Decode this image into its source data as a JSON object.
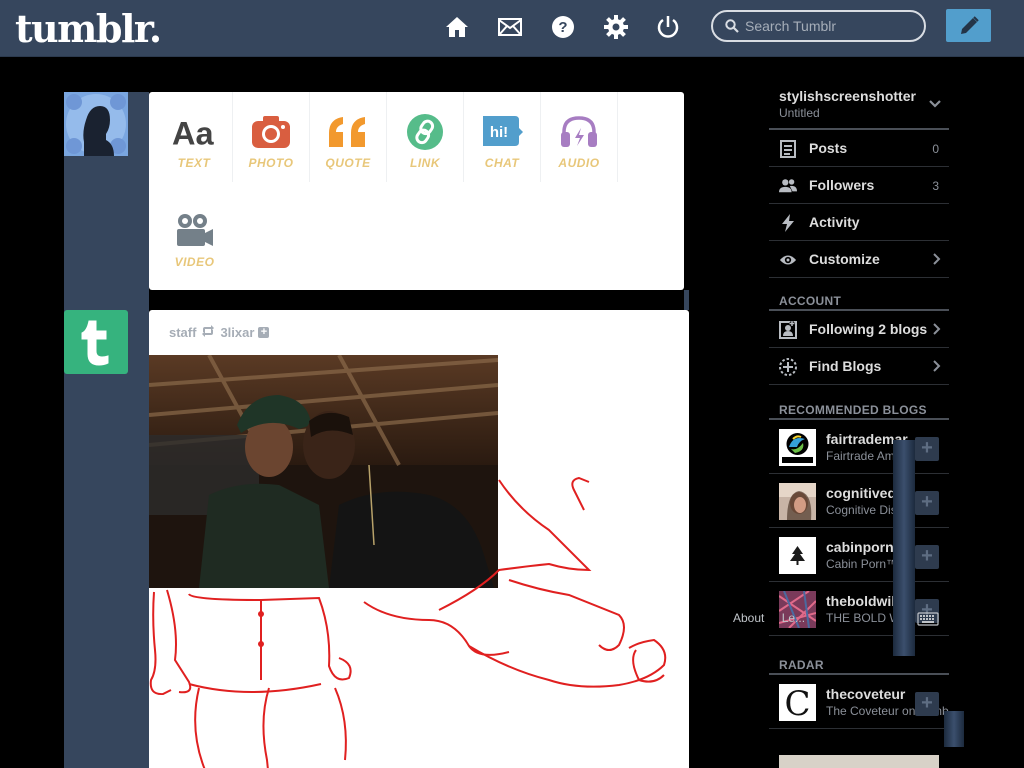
{
  "header": {
    "logo": "tumblr.",
    "nav_icons": [
      "home-icon",
      "mail-icon",
      "help-icon",
      "gear-icon",
      "power-icon"
    ],
    "search_placeholder": "Search Tumblr",
    "compose_icon": "pencil-icon",
    "colors": {
      "background": "#36465d",
      "accent": "#529ecc"
    }
  },
  "composer": {
    "post_types": [
      {
        "label": "TEXT",
        "icon": "text-aa-icon",
        "color": "#444444"
      },
      {
        "label": "PHOTO",
        "icon": "camera-icon",
        "color": "#d95e40"
      },
      {
        "label": "QUOTE",
        "icon": "quote-icon",
        "color": "#f2992e"
      },
      {
        "label": "LINK",
        "icon": "link-icon",
        "color": "#56bc8a"
      },
      {
        "label": "CHAT",
        "icon": "chat-icon",
        "color": "#529ecc"
      },
      {
        "label": "AUDIO",
        "icon": "headphones-icon",
        "color": "#a77dc2"
      },
      {
        "label": "VIDEO",
        "icon": "video-camera-icon",
        "color": "#748089"
      }
    ]
  },
  "post": {
    "author": "staff",
    "reblog_icon": "reblog-icon",
    "reblogged_from": "3lixar",
    "follow_icon": "plus-icon"
  },
  "sidebar": {
    "blog_name": "stylishscreenshotter",
    "blog_title": "Untitled",
    "items": [
      {
        "label": "Posts",
        "count": "0",
        "icon": "posts-icon"
      },
      {
        "label": "Followers",
        "count": "3",
        "icon": "followers-icon"
      },
      {
        "label": "Activity",
        "count": "",
        "icon": "lightning-icon"
      },
      {
        "label": "Customize",
        "count": "",
        "icon": "eye-icon"
      }
    ],
    "account_heading": "ACCOUNT",
    "account_items": [
      {
        "label": "Following 2 blogs",
        "icon": "following-icon"
      },
      {
        "label": "Find Blogs",
        "icon": "compass-icon"
      }
    ],
    "recommended_heading": "RECOMMENDED BLOGS",
    "recommended": [
      {
        "name": "fairtrademar",
        "desc": "Fairtrade Ame"
      },
      {
        "name": "cognitivedis",
        "desc": "Cognitive Diss"
      },
      {
        "name": "cabinporn",
        "desc": "Cabin Porn™"
      },
      {
        "name": "theboldwill",
        "desc": "THE BOLD W"
      }
    ],
    "radar_heading": "RADAR",
    "radar": {
      "name": "thecoveteur",
      "desc": "The Coveteur on Tumb"
    }
  },
  "footer_overlay": [
    "About",
    "Le..."
  ]
}
